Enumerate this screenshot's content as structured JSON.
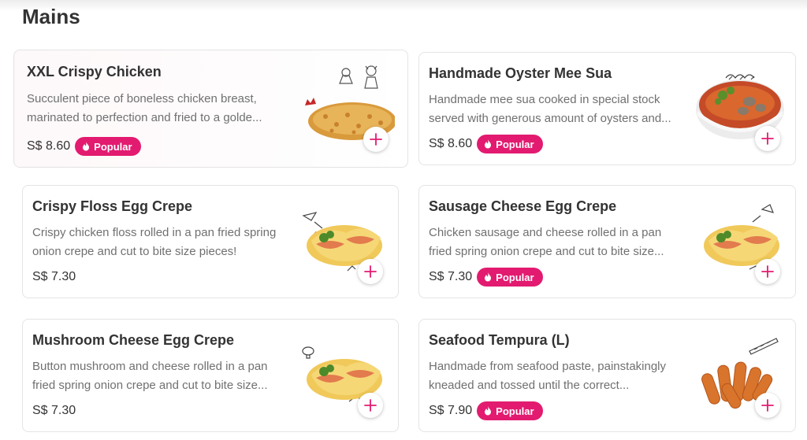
{
  "section": {
    "title": "Mains"
  },
  "colors": {
    "accent": "#e21b70",
    "text": "#333333",
    "muted": "#707070"
  },
  "items": [
    {
      "name": "XXL Crispy Chicken",
      "desc_line1": "Succulent piece of boneless chicken breast,",
      "desc_line2": "marinated to perfection and fried to a golde...",
      "price": "S$ 8.60",
      "badge": "Popular",
      "image": "crispy-chicken-image"
    },
    {
      "name": "Handmade Oyster Mee Sua",
      "desc_line1": "Handmade mee sua cooked in special stock",
      "desc_line2": "served with generous amount of oysters and...",
      "price": "S$ 8.60",
      "badge": "Popular",
      "image": "mee-sua-bowl-image"
    },
    {
      "name": "Crispy Floss Egg Crepe",
      "desc_line1": "Crispy chicken floss rolled in a pan fried spring",
      "desc_line2": "onion crepe and cut to bite size pieces!",
      "price": "S$ 7.30",
      "badge": null,
      "image": "egg-crepe-image"
    },
    {
      "name": "Sausage Cheese Egg Crepe",
      "desc_line1": "Chicken sausage and cheese rolled in a pan",
      "desc_line2": "fried spring onion crepe and cut to bite size...",
      "price": "S$ 7.30",
      "badge": "Popular",
      "image": "egg-crepe-image"
    },
    {
      "name": "Mushroom Cheese Egg Crepe",
      "desc_line1": "Button mushroom and cheese rolled in a pan",
      "desc_line2": "fried spring onion crepe and cut to bite size...",
      "price": "S$ 7.30",
      "badge": null,
      "image": "egg-crepe-image"
    },
    {
      "name": "Seafood Tempura (L)",
      "desc_line1": "Handmade from seafood paste, painstakingly",
      "desc_line2": "kneaded and tossed until the correct...",
      "price": "S$ 7.90",
      "badge": "Popular",
      "image": "tempura-image"
    }
  ]
}
